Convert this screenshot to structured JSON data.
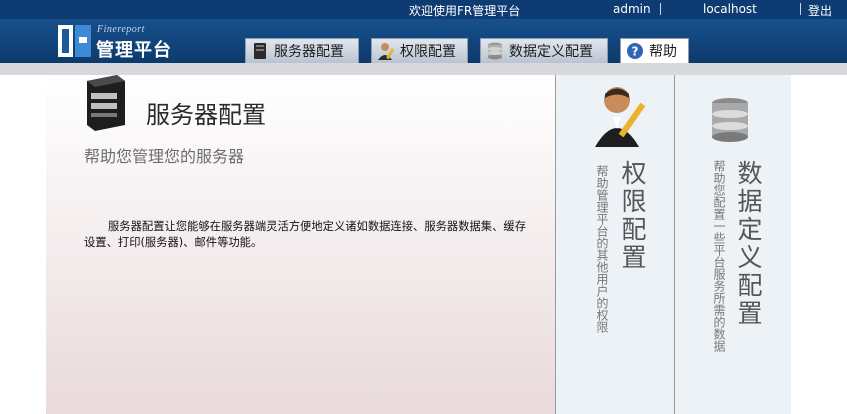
{
  "topbar": {
    "welcome": "欢迎使用FR管理平台",
    "user": "admin",
    "host": "localhost",
    "logout": "登出"
  },
  "logo": {
    "small": "Finereport",
    "big": "管理平台"
  },
  "tabs": [
    {
      "label": "服务器配置",
      "icon": "server-icon"
    },
    {
      "label": "权限配置",
      "icon": "user-pen-icon"
    },
    {
      "label": "数据定义配置",
      "icon": "database-icon"
    },
    {
      "label": "帮助",
      "icon": "help-icon",
      "active": true
    }
  ],
  "main": {
    "title": "服务器配置",
    "subtitle": "帮助您管理您的服务器",
    "description": "服务器配置让您能够在服务器端灵活方便地定义诸如数据连接、服务器数据集、缓存设置、打印(服务器)、邮件等功能。"
  },
  "panels": [
    {
      "title": "权限配置",
      "subtitle": "帮助管理平台的其他用户的权限",
      "icon": "user-pen-icon"
    },
    {
      "title": "数据定义配置",
      "subtitle": "帮助您配置一些平台服务所需的数据",
      "icon": "database-icon"
    }
  ],
  "colors": {
    "topbar": "#0e3c72",
    "header": "#17508d",
    "panel_bg": "#edf2f7"
  }
}
